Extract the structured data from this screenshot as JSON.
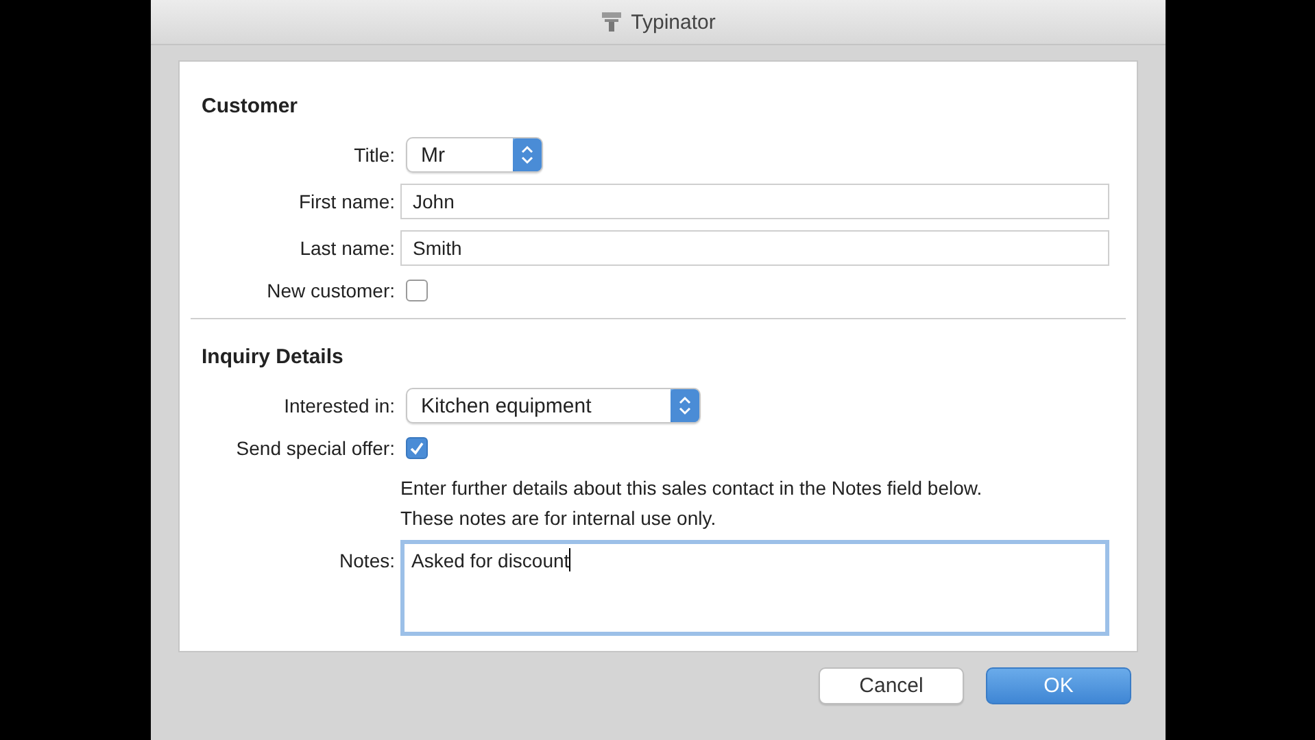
{
  "window": {
    "title": "Typinator"
  },
  "sections": [
    {
      "heading": "Customer",
      "fields": [
        {
          "kind": "popup",
          "label": "Title:",
          "value": "Mr"
        },
        {
          "kind": "text",
          "label": "First name:",
          "value": "John"
        },
        {
          "kind": "text",
          "label": "Last name:",
          "value": "Smith"
        },
        {
          "kind": "checkbox",
          "label": "New customer:",
          "checked": false
        }
      ]
    },
    {
      "heading": "Inquiry Details",
      "fields": [
        {
          "kind": "popup",
          "label": "Interested in:",
          "value": "Kitchen equipment"
        },
        {
          "kind": "checkbox",
          "label": "Send special offer:",
          "checked": true
        },
        {
          "kind": "note",
          "lines": [
            "Enter further details about this sales contact in the Notes field below.",
            "These notes are for internal use only."
          ]
        },
        {
          "kind": "textarea",
          "label": "Notes:",
          "value": "Asked for discount",
          "focused": true
        }
      ]
    }
  ],
  "buttons": [
    {
      "label": "Cancel",
      "default": false
    },
    {
      "label": "OK",
      "default": true
    }
  ]
}
